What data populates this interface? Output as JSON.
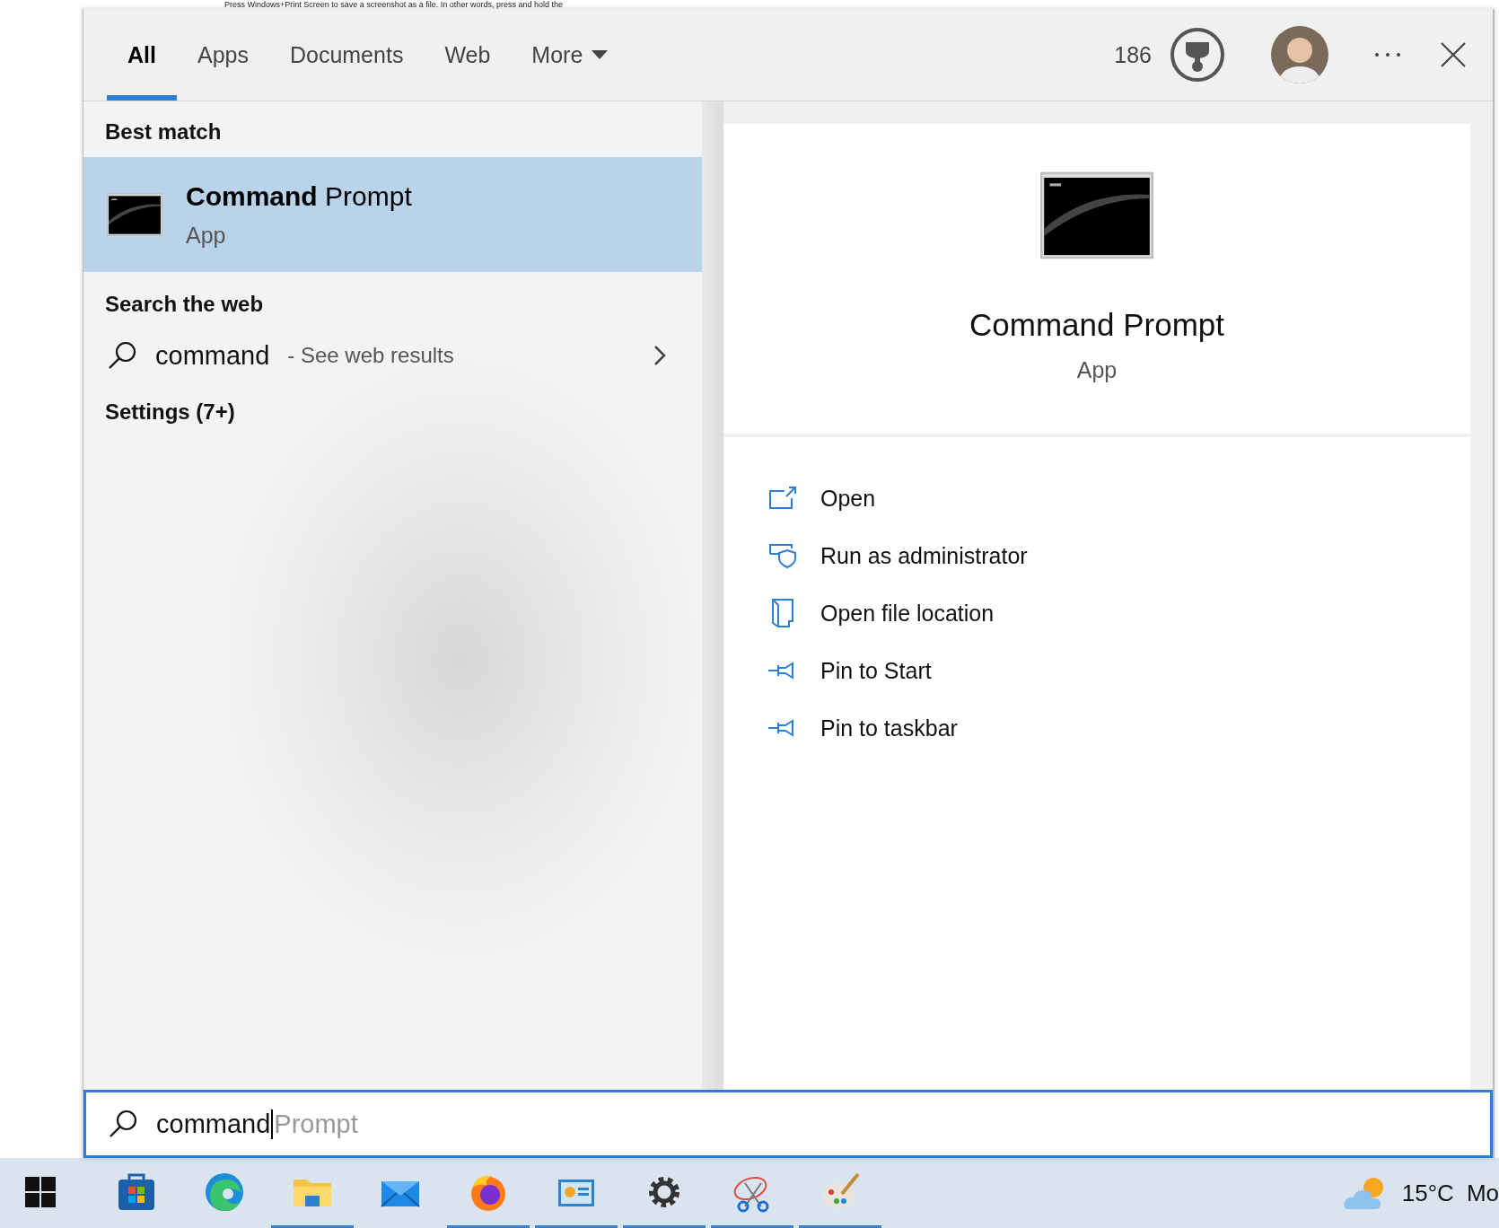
{
  "background_text": "Press Windows+Print Screen to save a screenshot as a file. In other words, press and hold the",
  "tabs": [
    {
      "label": "All",
      "kind": "tab",
      "selected": true
    },
    {
      "label": "Apps",
      "kind": "tab",
      "selected": false
    },
    {
      "label": "Documents",
      "kind": "tab",
      "selected": false
    },
    {
      "label": "Web",
      "kind": "tab",
      "selected": false
    },
    {
      "label": "More",
      "kind": "menu",
      "selected": false
    }
  ],
  "header": {
    "points": "186"
  },
  "results": {
    "best_match_heading": "Best match",
    "best_match": {
      "title": "**Command** Prompt",
      "type": "App",
      "selected": true
    },
    "web_heading": "Search the web",
    "web_result": {
      "query": "command",
      "suffix": "- See web results"
    },
    "settings_heading": "Settings (7+)"
  },
  "preview": {
    "title": "Command Prompt",
    "subtitle": "App",
    "actions": [
      {
        "kind": "open",
        "label": "Open"
      },
      {
        "kind": "admin",
        "label": "Run as administrator"
      },
      {
        "kind": "location",
        "label": "Open file location"
      },
      {
        "kind": "pin",
        "label": "Pin to Start"
      },
      {
        "kind": "pin",
        "label": "Pin to taskbar"
      }
    ]
  },
  "search": {
    "value": "command",
    "suggestion": "Prompt"
  },
  "taskbar": {
    "apps": [
      {
        "kind": "store",
        "running": false
      },
      {
        "kind": "edge",
        "running": false
      },
      {
        "kind": "folder",
        "running": true
      },
      {
        "kind": "mail",
        "running": false
      },
      {
        "kind": "firefox",
        "running": true
      },
      {
        "kind": "control",
        "running": true
      },
      {
        "kind": "settings",
        "running": true
      },
      {
        "kind": "snip",
        "running": true
      },
      {
        "kind": "paint",
        "running": true
      }
    ],
    "temperature": "15°C",
    "clock": "Mo"
  }
}
